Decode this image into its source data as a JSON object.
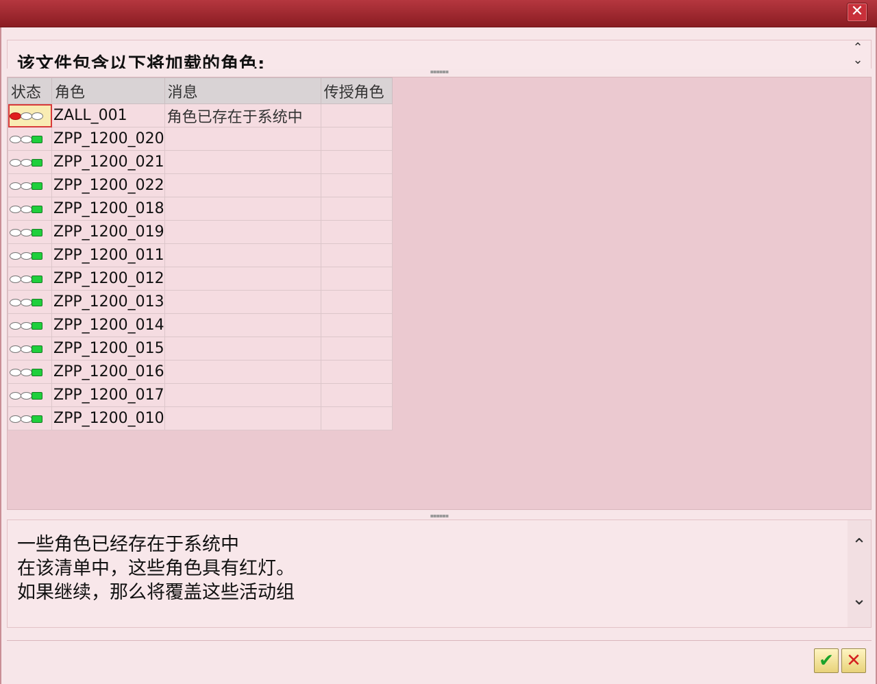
{
  "header": {
    "text": "该文件包含以下将加载的角色:"
  },
  "table": {
    "columns": [
      "状态",
      "角色",
      "消息",
      "传授角色"
    ],
    "rows": [
      {
        "role": "ZALL_001",
        "message": "角色已存在于系统中",
        "light": "red"
      },
      {
        "role": "ZPP_1200_020",
        "message": "",
        "light": "green"
      },
      {
        "role": "ZPP_1200_021",
        "message": "",
        "light": "green"
      },
      {
        "role": "ZPP_1200_022",
        "message": "",
        "light": "green"
      },
      {
        "role": "ZPP_1200_018",
        "message": "",
        "light": "green"
      },
      {
        "role": "ZPP_1200_019",
        "message": "",
        "light": "green"
      },
      {
        "role": "ZPP_1200_011",
        "message": "",
        "light": "green"
      },
      {
        "role": "ZPP_1200_012",
        "message": "",
        "light": "green"
      },
      {
        "role": "ZPP_1200_013",
        "message": "",
        "light": "green"
      },
      {
        "role": "ZPP_1200_014",
        "message": "",
        "light": "green"
      },
      {
        "role": "ZPP_1200_015",
        "message": "",
        "light": "green"
      },
      {
        "role": "ZPP_1200_016",
        "message": "",
        "light": "green"
      },
      {
        "role": "ZPP_1200_017",
        "message": "",
        "light": "green"
      },
      {
        "role": "ZPP_1200_010",
        "message": "",
        "light": "green"
      }
    ]
  },
  "info": {
    "lines": [
      "一些角色已经存在于系统中",
      "在该清单中，这些角色具有红灯。",
      "如果继续，那么将覆盖这些活动组"
    ]
  },
  "buttons": {
    "close": "✕",
    "ok": "✔",
    "cancel": "✕"
  },
  "colors": {
    "titlebar": "#9b2229",
    "red_light": "#e01e1e",
    "green_light": "#1fcf3c"
  }
}
